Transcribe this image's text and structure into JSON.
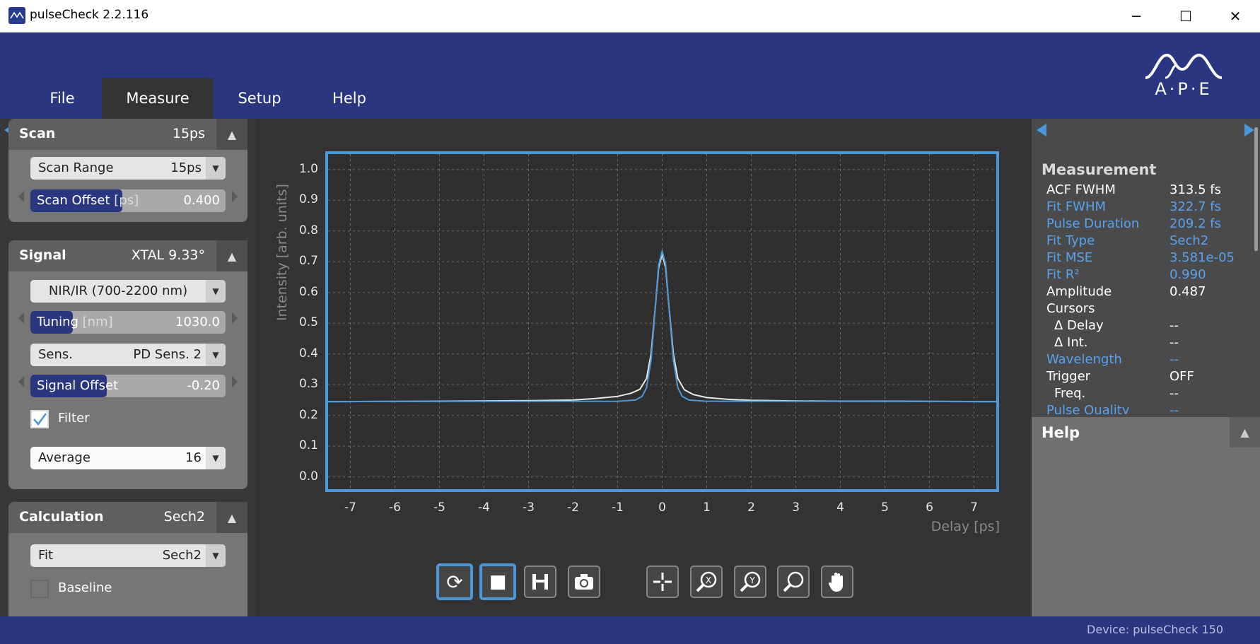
{
  "window": {
    "title": "pulseCheck 2.2.116",
    "minimize": "─",
    "maximize": "☐",
    "close": "✕"
  },
  "menu": {
    "file": "File",
    "measure": "Measure",
    "setup": "Setup",
    "help": "Help"
  },
  "logo": {
    "text": "A·P·E"
  },
  "scan": {
    "title": "Scan",
    "value": "15ps",
    "range_label": "Scan Range",
    "range_value": "15ps",
    "offset_label": "Scan Offset",
    "offset_unit": "[ps]",
    "offset_value": "0.400"
  },
  "signal": {
    "title": "Signal",
    "value": "XTAL 9.33°",
    "band": "NIR/IR (700-2200 nm)",
    "tuning_label": "Tuning",
    "tuning_unit": "[nm]",
    "tuning_value": "1030.0",
    "sens_label": "Sens.",
    "sens_value": "PD Sens. 2",
    "offset_label": "Signal Offset",
    "offset_value": "-0.20",
    "filter_label": "Filter",
    "filter_checked": true,
    "average_label": "Average",
    "average_value": "16"
  },
  "calculation": {
    "title": "Calculation",
    "value": "Sech2",
    "fit_label": "Fit",
    "fit_value": "Sech2",
    "baseline_label": "Baseline",
    "baseline_checked": false
  },
  "chart_data": {
    "type": "line",
    "xlabel": "Delay [ps]",
    "ylabel": "Intensity [arb. units]",
    "xlim": [
      -7.5,
      7.5
    ],
    "ylim": [
      -0.04,
      1.05
    ],
    "xticks": [
      "-7",
      "-6",
      "-5",
      "-4",
      "-3",
      "-2",
      "-1",
      "0",
      "1",
      "2",
      "3",
      "4",
      "5",
      "6",
      "7"
    ],
    "yticks": [
      "0.0",
      "0.1",
      "0.2",
      "0.3",
      "0.4",
      "0.5",
      "0.6",
      "0.7",
      "0.8",
      "0.9",
      "1.0"
    ],
    "grid": true,
    "series": [
      {
        "role": "measured",
        "color": "#e8e8e8",
        "x": [
          -7.5,
          -5,
          -3,
          -2,
          -1.5,
          -1,
          -0.7,
          -0.5,
          -0.35,
          -0.25,
          -0.15,
          -0.08,
          0,
          0.08,
          0.15,
          0.25,
          0.35,
          0.5,
          0.7,
          1,
          1.5,
          2,
          3,
          4,
          5,
          7.5
        ],
        "y": [
          0.245,
          0.246,
          0.248,
          0.25,
          0.255,
          0.262,
          0.272,
          0.285,
          0.32,
          0.4,
          0.56,
          0.68,
          0.725,
          0.68,
          0.56,
          0.4,
          0.32,
          0.283,
          0.268,
          0.258,
          0.252,
          0.249,
          0.247,
          0.246,
          0.246,
          0.245
        ]
      },
      {
        "role": "fit",
        "color": "#4a98db",
        "x": [
          -7.5,
          -1,
          -0.6,
          -0.45,
          -0.35,
          -0.25,
          -0.15,
          -0.08,
          0,
          0.08,
          0.15,
          0.25,
          0.35,
          0.45,
          0.6,
          1,
          7.5
        ],
        "y": [
          0.245,
          0.246,
          0.25,
          0.262,
          0.29,
          0.38,
          0.56,
          0.69,
          0.735,
          0.69,
          0.56,
          0.38,
          0.29,
          0.262,
          0.25,
          0.246,
          0.245
        ]
      }
    ]
  },
  "toolbar": {
    "loop": "⟳",
    "stop": "■",
    "save": "💾",
    "camera": "📷",
    "cursor": "✛",
    "zoom_x": "X",
    "zoom_y": "Y",
    "zoom": "⌕",
    "pan": "✋"
  },
  "measurement": {
    "title": "Measurement",
    "rows": [
      {
        "label": "ACF FWHM",
        "value": "313.5 fs",
        "color": "white"
      },
      {
        "label": "Fit FWHM",
        "value": "322.7 fs",
        "color": "blue"
      },
      {
        "label": "Pulse Duration",
        "value": "209.2 fs",
        "color": "blue"
      },
      {
        "label": "Fit Type",
        "value": "Sech2",
        "color": "blue"
      },
      {
        "label": "Fit MSE",
        "value": "3.581e-05",
        "color": "blue"
      },
      {
        "label": "Fit R²",
        "value": "0.990",
        "color": "blue"
      },
      {
        "label": "Amplitude",
        "value": "0.487",
        "color": "white"
      },
      {
        "label": "Cursors",
        "value": "",
        "color": "white"
      },
      {
        "label": "Δ Delay",
        "value": "--",
        "color": "white",
        "indent": true
      },
      {
        "label": "Δ Int.",
        "value": "--",
        "color": "white",
        "indent": true
      },
      {
        "label": "Wavelength",
        "value": "--",
        "color": "blue"
      },
      {
        "label": "Trigger",
        "value": "OFF",
        "color": "white"
      },
      {
        "label": "Freq.",
        "value": "--",
        "color": "white",
        "indent": true
      },
      {
        "label": "Pulse Quality",
        "value": "--",
        "color": "blue"
      }
    ]
  },
  "help": {
    "title": "Help"
  },
  "status": {
    "device": "Device: pulseCheck 150"
  }
}
